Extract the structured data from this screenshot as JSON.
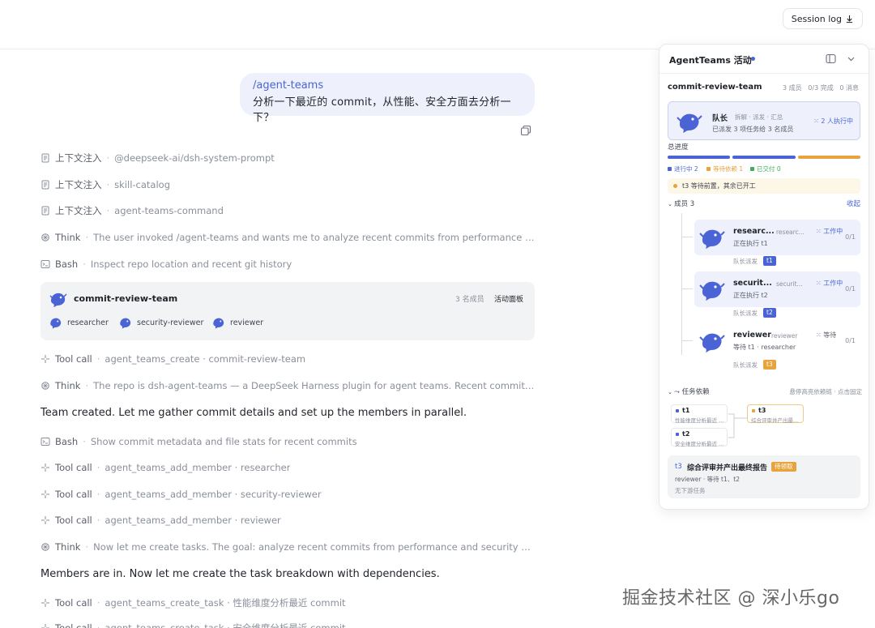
{
  "header": {
    "session_log_label": "Session log"
  },
  "user_message": {
    "command": "/agent-teams",
    "text": "分析一下最近的 commit，从性能、安全方面去分析一下？"
  },
  "steps": [
    {
      "kind": "上下文注入",
      "detail": "@deepseek-ai/dsh-system-prompt",
      "icon": "document-icon"
    },
    {
      "kind": "上下文注入",
      "detail": "skill-catalog",
      "icon": "document-icon"
    },
    {
      "kind": "上下文注入",
      "detail": "agent-teams-command",
      "icon": "document-icon"
    },
    {
      "kind": "Think",
      "detail": "The user invoked /agent-teams and wants me to analyze recent commits from performance and securi...",
      "icon": "brain-icon"
    },
    {
      "kind": "Bash",
      "detail": "Inspect repo location and recent git history",
      "icon": "terminal-icon"
    },
    {
      "kind": "Tool call",
      "detail": "agent_teams_create · commit-review-team",
      "icon": "sparkle-icon"
    },
    {
      "kind": "Think",
      "detail": "The repo is dsh-agent-teams — a DeepSeek Harness plugin for agent teams. Recent commits are mos...",
      "icon": "brain-icon"
    },
    {
      "kind": "Bash",
      "detail": "Show commit metadata and file stats for recent commits",
      "icon": "terminal-icon"
    },
    {
      "kind": "Tool call",
      "detail": "agent_teams_add_member · researcher",
      "icon": "sparkle-icon"
    },
    {
      "kind": "Tool call",
      "detail": "agent_teams_add_member · security-reviewer",
      "icon": "sparkle-icon"
    },
    {
      "kind": "Tool call",
      "detail": "agent_teams_add_member · reviewer",
      "icon": "sparkle-icon"
    },
    {
      "kind": "Think",
      "detail": "Now let me create tasks. The goal: analyze recent commits from performance and security perspectiv...",
      "icon": "brain-icon"
    },
    {
      "kind": "Tool call",
      "detail": "agent_teams_create_task · 性能维度分析最近 commit",
      "icon": "sparkle-icon"
    },
    {
      "kind": "Tool call",
      "detail": "agent_teams_create_task · 安全维度分析最近 commit",
      "icon": "sparkle-icon"
    }
  ],
  "paragraphs": {
    "team_created": "Team created. Let me gather commit details and set up the members in parallel.",
    "members_in": "Members are in. Now let me create the task breakdown with dependencies."
  },
  "team_card": {
    "name": "commit-review-team",
    "member_count": "3 名成员",
    "panel_link": "活动面板",
    "members": [
      "researcher",
      "security-reviewer",
      "reviewer"
    ]
  },
  "panel": {
    "title": "AgentTeams 活动",
    "team_name": "commit-review-team",
    "stats": "3 成员   0/3 完成   0 消息",
    "lead": {
      "name": "队长",
      "sub": "拆解 · 派发 · 汇总",
      "desc": "已派发 3 项任务给 3 名成员",
      "status": "2 人执行中"
    },
    "progress_label": "总进度",
    "progress": {
      "in_progress": 2,
      "waiting": 1,
      "delivered": 0,
      "total": 3
    },
    "legend": {
      "in_progress": "进行中 2",
      "waiting": "等待依赖 1",
      "delivered": "已交付 0"
    },
    "warning": "t3 等待前置，其余已开工",
    "members_label": "成员 3",
    "collapse_label": "收起",
    "members": [
      {
        "name": "researc...",
        "role": "researc...",
        "state": "工作中",
        "doing": "正在执行 t1",
        "count": "0/1",
        "assign": "队长派发",
        "tag": "t1"
      },
      {
        "name": "securit...",
        "role": "securit...",
        "state": "工作中",
        "doing": "正在执行 t2",
        "count": "0/1",
        "assign": "队长派发",
        "tag": "t2"
      },
      {
        "name": "reviewer",
        "role": "reviewer",
        "state": "等待",
        "doing": "等待 t1 · researcher",
        "count": "0/1",
        "assign": "队长派发",
        "tag": "t3"
      }
    ],
    "deps_label": "任务依赖",
    "deps_hint": "悬停高亮依赖链 · 点击固定",
    "dep_nodes": [
      {
        "id": "t1",
        "text": "性能维度分析最近 ..."
      },
      {
        "id": "t2",
        "text": "安全维度分析最近 ..."
      },
      {
        "id": "t3",
        "text": "综合评审并产出最..."
      }
    ],
    "task_detail": {
      "id": "t3",
      "title": "综合评审并产出最终报告",
      "badge": "待领取",
      "line1": "reviewer · 等待 t1、t2",
      "line2": "无下游任务"
    }
  },
  "colors": {
    "accent": "#4a64d6",
    "waiting": "#e8a33d",
    "done": "#3fae5a"
  },
  "watermark": "掘金技术社区 @ 深小乐go"
}
